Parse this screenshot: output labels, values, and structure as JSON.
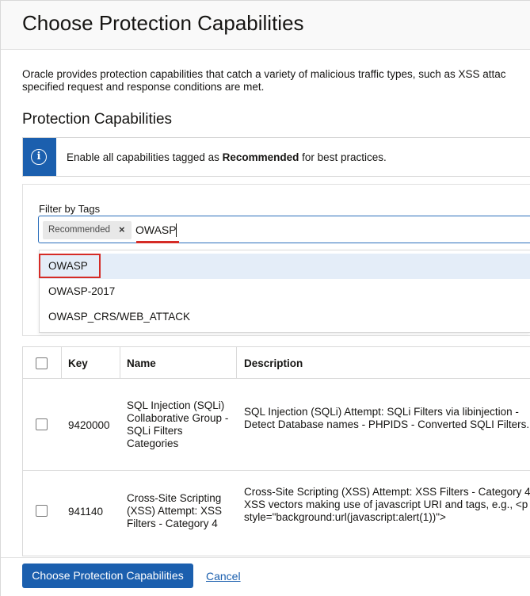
{
  "header": {
    "title": "Choose Protection Capabilities"
  },
  "intro": {
    "line1": "Oracle provides protection capabilities that catch a variety of malicious traffic types, such as XSS attac",
    "line2": "specified request and response conditions are met."
  },
  "section": {
    "title": "Protection Capabilities"
  },
  "info_banner": {
    "icon": "info-icon",
    "prefix": "Enable all capabilities tagged as ",
    "bold": "Recommended",
    "suffix": " for best practices."
  },
  "filter": {
    "label": "Filter by Tags",
    "chips": [
      {
        "label": "Recommended",
        "remove_glyph": "×"
      }
    ],
    "input_value": "OWASP",
    "suggestions": [
      "OWASP",
      "OWASP-2017",
      "OWASP_CRS/WEB_ATTACK"
    ],
    "selected_index": 0
  },
  "table": {
    "headers": {
      "key": "Key",
      "name": "Name",
      "description": "Description"
    },
    "rows": [
      {
        "key": "9420000",
        "name": "SQL Injection (SQLi) Collaborative Group - SQLi Filters Categories",
        "description": "SQL Injection (SQLi) Attempt: SQLi Filters via libinjection - Detect Database names - PHPIDS - Converted SQLI Filters."
      },
      {
        "key": "941140",
        "name": "Cross-Site Scripting (XSS) Attempt: XSS Filters - Category 4",
        "description": "Cross-Site Scripting (XSS) Attempt: XSS Filters - Category 4. XSS vectors making use of javascript URI and tags, e.g., <p style=\"background:url(javascript:alert(1))\">"
      }
    ]
  },
  "footer": {
    "primary_label": "Choose Protection Capabilities",
    "cancel_label": "Cancel"
  },
  "colors": {
    "accent": "#1b5fae",
    "highlight_red": "#d52b26",
    "selected_bg": "#e4edf8"
  }
}
